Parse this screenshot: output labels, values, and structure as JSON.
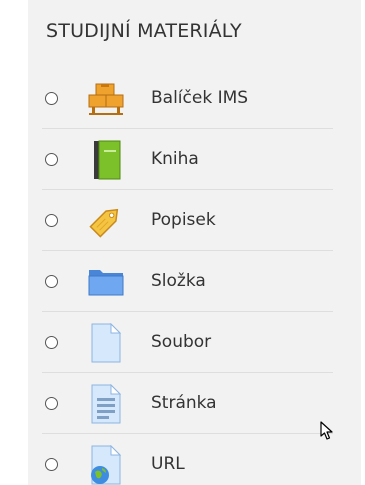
{
  "panel": {
    "title": "STUDIJNÍ MATERIÁLY"
  },
  "items": [
    {
      "label": "Balíček IMS",
      "icon": "ims-package-icon"
    },
    {
      "label": "Kniha",
      "icon": "book-icon"
    },
    {
      "label": "Popisek",
      "icon": "label-tag-icon"
    },
    {
      "label": "Složka",
      "icon": "folder-icon"
    },
    {
      "label": "Soubor",
      "icon": "file-icon"
    },
    {
      "label": "Stránka",
      "icon": "page-icon"
    },
    {
      "label": "URL",
      "icon": "url-icon"
    }
  ],
  "colors": {
    "panel_bg": "#f2f2f2",
    "text": "#333333",
    "ims_orange": "#f0a22e",
    "book_green": "#7cc02a",
    "tag_yellow": "#f4c542",
    "folder_blue": "#6fa8f0",
    "doc_blue": "#d6e8fb"
  }
}
